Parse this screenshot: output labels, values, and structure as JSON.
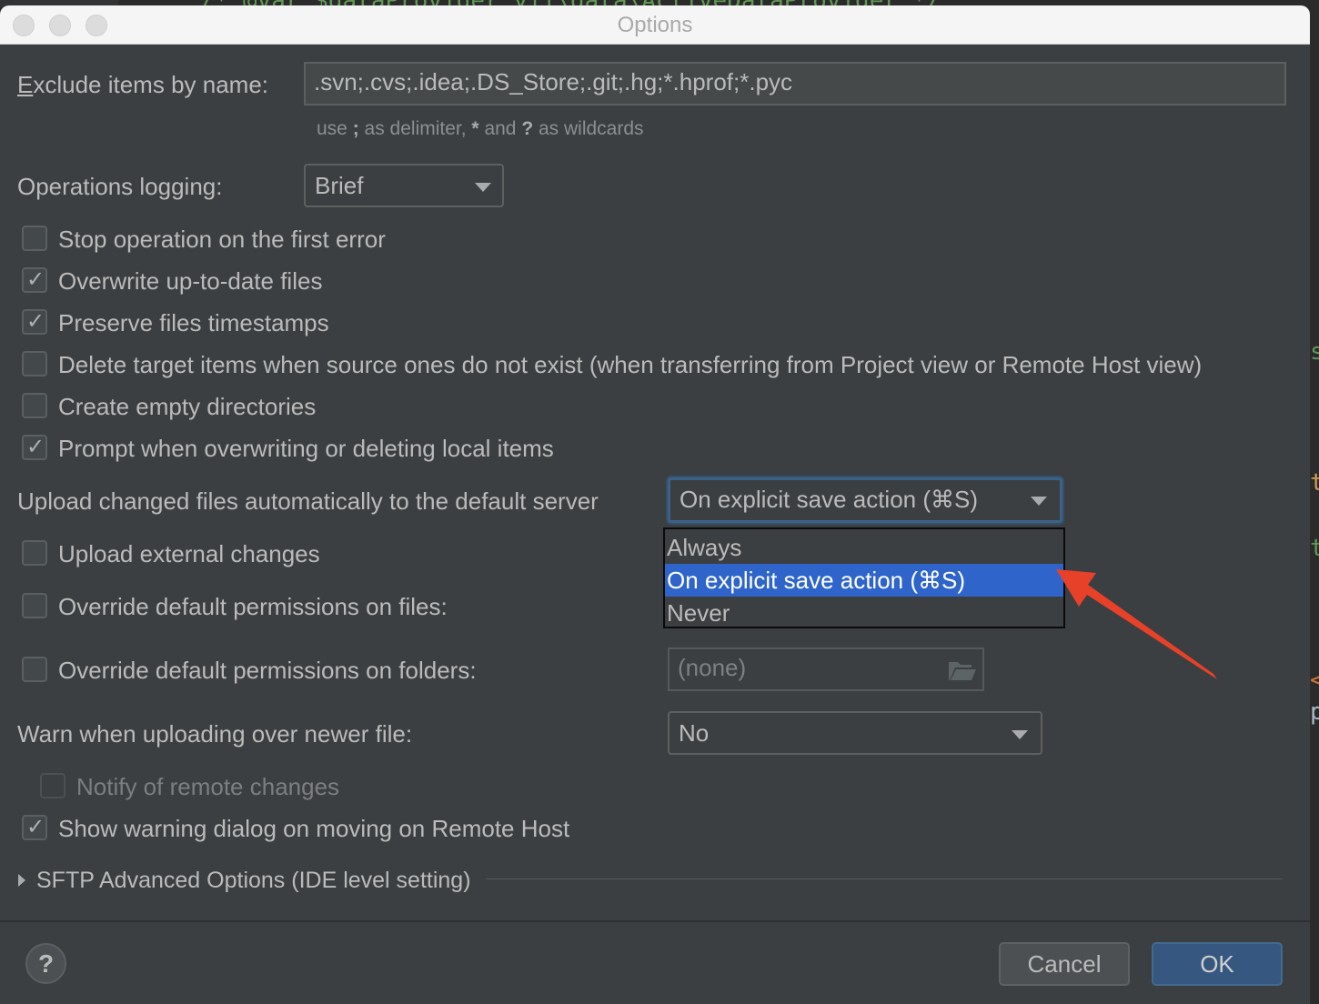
{
  "background_ide": {
    "code_top": "/* @var $dataProvider yii\\data\\ActiveDataProvider */",
    "edge_chars": [
      "s",
      "t",
      "t",
      "<",
      "p"
    ]
  },
  "window": {
    "title": "Options",
    "controls": [
      "close",
      "minimize",
      "zoom"
    ]
  },
  "exclude": {
    "label": "Exclude items by name:",
    "mnemonic": "E",
    "label_rest": "xclude items by name:",
    "value": ".svn;.cvs;.idea;.DS_Store;.git;.hg;*.hprof;*.pyc",
    "hint_prefix": "use ",
    "hint_semicolon": ";",
    "hint_mid1": " as delimiter, ",
    "hint_star": "*",
    "hint_mid2": " and ",
    "hint_q": "?",
    "hint_suffix": " as wildcards"
  },
  "logging": {
    "label": "Operations logging:",
    "value": "Brief"
  },
  "checkboxes": [
    {
      "label": "Stop operation on the first error",
      "checked": false
    },
    {
      "label": "Overwrite up-to-date files",
      "checked": true
    },
    {
      "label": "Preserve files timestamps",
      "checked": true
    },
    {
      "label": "Delete target items when source ones do not exist (when transferring from Project view or Remote Host view)",
      "checked": false
    },
    {
      "label": "Create empty directories",
      "checked": false
    },
    {
      "label": "Prompt when overwriting or deleting local items",
      "checked": true
    }
  ],
  "upload": {
    "label": "Upload changed files automatically to the default server",
    "value": "On explicit save action (⌘S)",
    "options": [
      "Always",
      "On explicit save action (⌘S)",
      "Never"
    ],
    "selected_index": 1
  },
  "upload_external": {
    "label": "Upload external changes",
    "checked": false
  },
  "perm_files": {
    "label": "Override default permissions on files:",
    "checked": false
  },
  "perm_folders": {
    "label": "Override default permissions on folders:",
    "checked": false,
    "value": "(none)"
  },
  "warn": {
    "label": "Warn when uploading over newer file:",
    "value": "No"
  },
  "notify_remote": {
    "label": "Notify of remote changes",
    "checked": false,
    "enabled": false
  },
  "show_warning": {
    "label": "Show warning dialog on moving on Remote Host",
    "checked": true
  },
  "sftp": {
    "label": "SFTP Advanced Options (IDE level setting)",
    "expanded": false
  },
  "footer": {
    "help_label": "?",
    "cancel_label": "Cancel",
    "ok_label": "OK"
  },
  "annotation": {
    "color": "#e8412a",
    "points_to": "On explicit save action (⌘S)"
  },
  "colors": {
    "selection": "#2f65ca",
    "ok_button": "#365880",
    "focus_ring": "#3d6185"
  }
}
